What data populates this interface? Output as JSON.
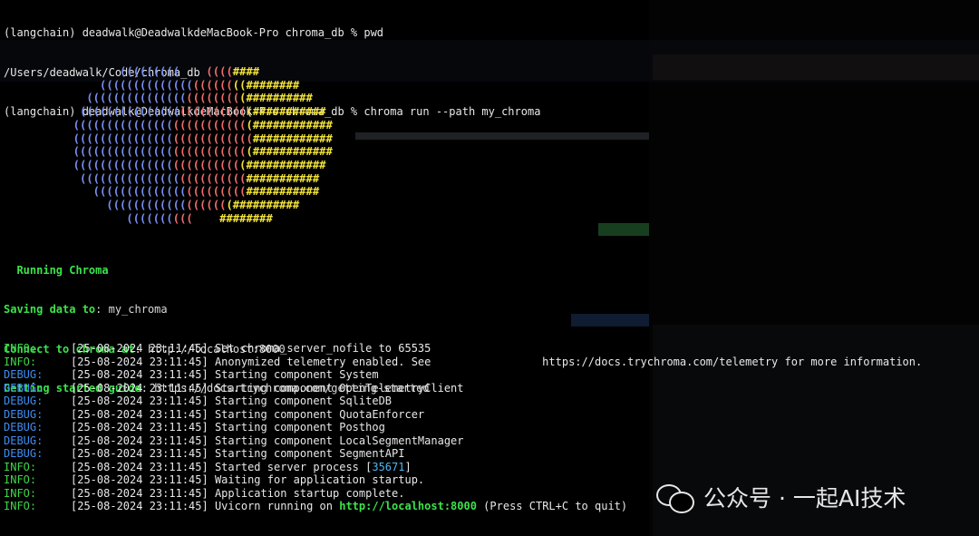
{
  "prompt_lines": [
    "(langchain) deadwalk@DeadwalkdeMacBook-Pro chroma_db % pwd",
    "/Users/deadwalk/Code/chroma_db",
    "(langchain) deadwalk@DeadwalkdeMacBook-Pro chroma_db % chroma run --path my_chroma"
  ],
  "logo": {
    "colors": {
      "blue": "#7a8ff0",
      "red": "#ef6d6d",
      "yellow": "#f3e33a"
    },
    "rows": [
      [
        [
          "b",
          "         ((((((((("
        ],
        [
          "r",
          "    (((("
        ],
        [
          "y",
          "####"
        ]
      ],
      [
        [
          "b",
          "      (((((((((((((("
        ],
        [
          "r",
          "(((((("
        ],
        [
          "y",
          "((########"
        ]
      ],
      [
        [
          "b",
          "    ((((((((((((((("
        ],
        [
          "r",
          "(((((((("
        ],
        [
          "y",
          "(##########"
        ]
      ],
      [
        [
          "b",
          "   ((((((((((((((("
        ],
        [
          "r",
          "(((((((((("
        ],
        [
          "y",
          "(###########"
        ]
      ],
      [
        [
          "b",
          "  ((((((((((((((("
        ],
        [
          "r",
          "((((((((((("
        ],
        [
          "y",
          "(############"
        ]
      ],
      [
        [
          "b",
          "  ((((((((((((((("
        ],
        [
          "r",
          "(((((((((((("
        ],
        [
          "y",
          "############"
        ]
      ],
      [
        [
          "b",
          "  ((((((((((((((("
        ],
        [
          "r",
          "((((((((((("
        ],
        [
          "y",
          "(############"
        ]
      ],
      [
        [
          "b",
          "  ((((((((((((((("
        ],
        [
          "r",
          "(((((((((("
        ],
        [
          "y",
          "(############"
        ]
      ],
      [
        [
          "b",
          "   ((((((((((((((("
        ],
        [
          "r",
          "(((((((((("
        ],
        [
          "y",
          "###########"
        ]
      ],
      [
        [
          "b",
          "     (((((((((((((("
        ],
        [
          "r",
          "((((((((("
        ],
        [
          "y",
          "###########"
        ]
      ],
      [
        [
          "b",
          "       (((((((((((("
        ],
        [
          "r",
          "(((((("
        ],
        [
          "y",
          "(##########"
        ]
      ],
      [
        [
          "b",
          "          ((((((("
        ],
        [
          "r",
          "((("
        ],
        [
          "y",
          "    ########"
        ]
      ]
    ]
  },
  "running": "Running Chroma",
  "config": [
    {
      "label": "Saving data to",
      "value": "my_chroma"
    },
    {
      "label": "Connect to chroma at",
      "value": "http://localhost:8000"
    },
    {
      "label": "Getting started guide",
      "value": "https://docs.trychroma.com/getting-started"
    }
  ],
  "logs": [
    {
      "level": "INFO:",
      "time": "[25-08-2024 23:11:45]",
      "msg": "Set chroma_server_nofile to 65535"
    },
    {
      "level": "INFO:",
      "time": "[25-08-2024 23:11:45]",
      "msg": "Anonymized telemetry enabled. See                 https://docs.trychroma.com/telemetry for more information."
    },
    {
      "level": "DEBUG:",
      "time": "[25-08-2024 23:11:45]",
      "msg": "Starting component System"
    },
    {
      "level": "DEBUG:",
      "time": "[25-08-2024 23:11:45]",
      "msg": "Starting component OpenTelemetryClient"
    },
    {
      "level": "DEBUG:",
      "time": "[25-08-2024 23:11:45]",
      "msg": "Starting component SqliteDB"
    },
    {
      "level": "DEBUG:",
      "time": "[25-08-2024 23:11:45]",
      "msg": "Starting component QuotaEnforcer"
    },
    {
      "level": "DEBUG:",
      "time": "[25-08-2024 23:11:45]",
      "msg": "Starting component Posthog"
    },
    {
      "level": "DEBUG:",
      "time": "[25-08-2024 23:11:45]",
      "msg": "Starting component LocalSegmentManager"
    },
    {
      "level": "DEBUG:",
      "time": "[25-08-2024 23:11:45]",
      "msg": "Starting component SegmentAPI"
    },
    {
      "level": "INFO:",
      "time": "[25-08-2024 23:11:45]",
      "msg": "Started server process [",
      "num": "35671",
      "tail": "]"
    },
    {
      "level": "INFO:",
      "time": "[25-08-2024 23:11:45]",
      "msg": "Waiting for application startup."
    },
    {
      "level": "INFO:",
      "time": "[25-08-2024 23:11:45]",
      "msg": "Application startup complete."
    },
    {
      "level": "INFO:",
      "time": "[25-08-2024 23:11:45]",
      "msg": "Uvicorn running on ",
      "bold": "http://localhost:8000",
      "tail": " (Press CTRL+C to quit)"
    }
  ],
  "watermark": {
    "icon": "wechat-icon",
    "text": "公众号 · 一起AI技术"
  },
  "colors": {
    "info": "#3fd44a",
    "debug": "#3e8df0",
    "accent_green": "#3be34b"
  }
}
